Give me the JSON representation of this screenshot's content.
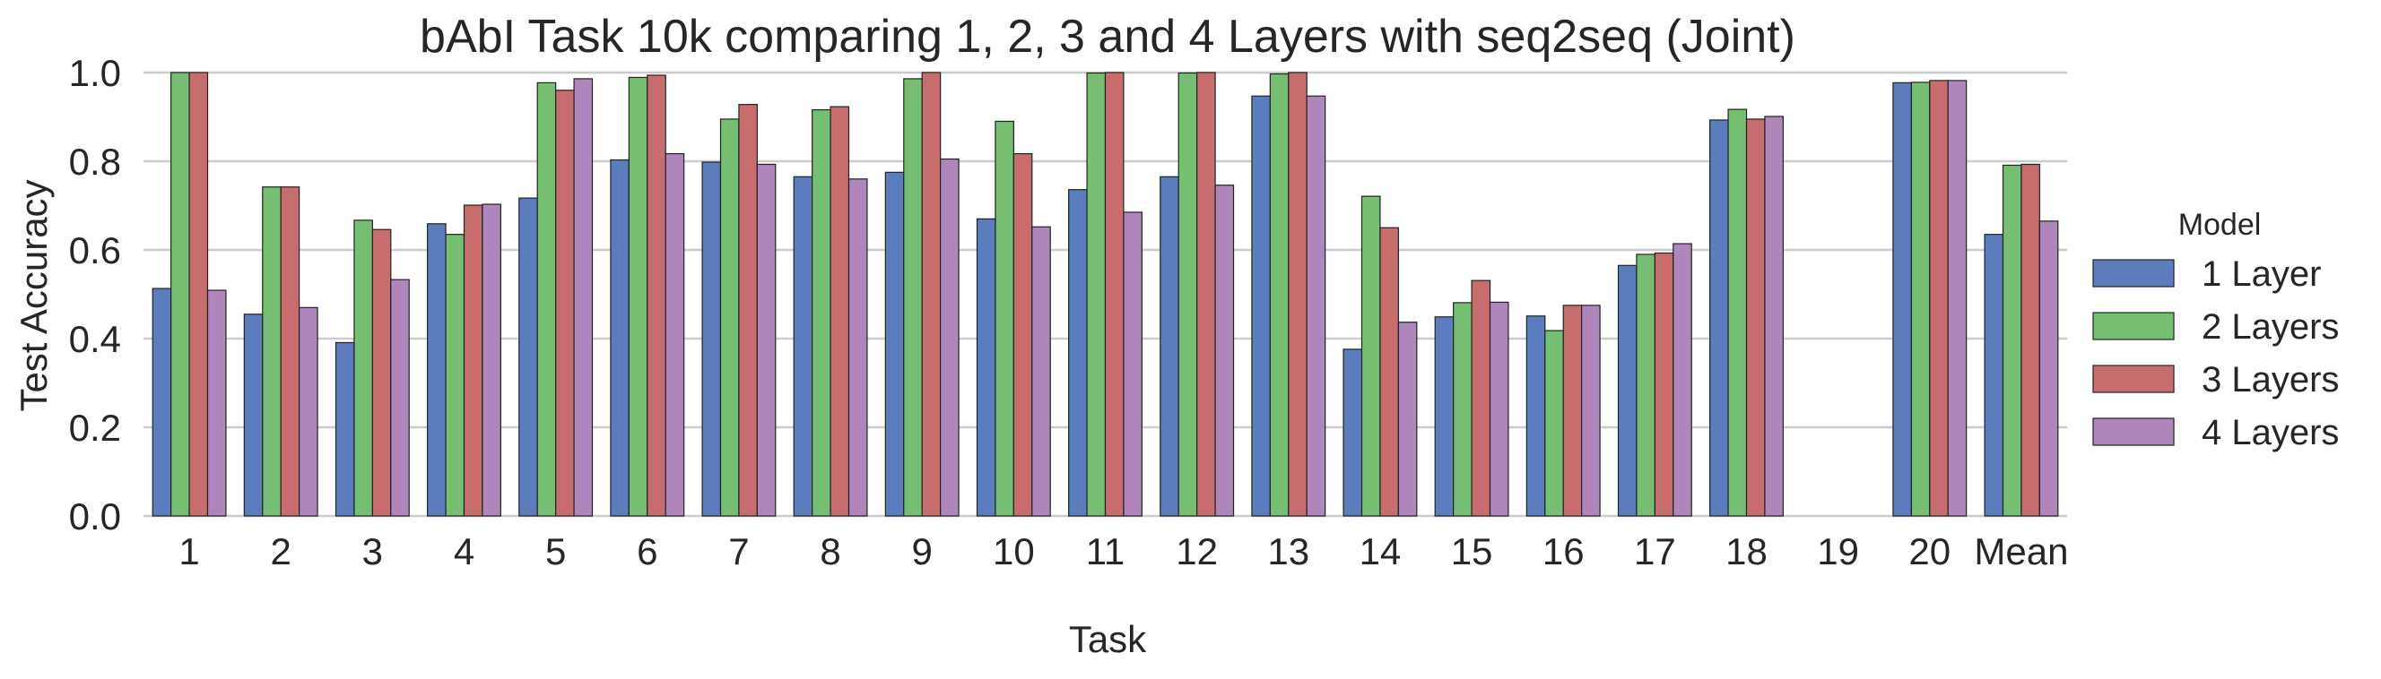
{
  "chart_data": {
    "type": "bar",
    "title": "bAbI Task 10k comparing 1, 2, 3 and 4 Layers with seq2seq (Joint)",
    "xlabel": "Task",
    "ylabel": "Test Accuracy",
    "ylim": [
      0.0,
      1.0
    ],
    "yticks": [
      "0.0",
      "0.2",
      "0.4",
      "0.6",
      "0.8",
      "1.0"
    ],
    "ytick_values": [
      0.0,
      0.2,
      0.4,
      0.6,
      0.8,
      1.0
    ],
    "grid": "horizontal",
    "categories": [
      "1",
      "2",
      "3",
      "4",
      "5",
      "6",
      "7",
      "8",
      "9",
      "10",
      "11",
      "12",
      "13",
      "14",
      "15",
      "16",
      "17",
      "18",
      "19",
      "20",
      "Mean"
    ],
    "legend": {
      "title": "Model",
      "placement": "right"
    },
    "series": [
      {
        "name": "1 Layer",
        "color": "#5b7dbe",
        "values": [
          0.513,
          0.455,
          0.391,
          0.659,
          0.717,
          0.803,
          0.798,
          0.765,
          0.775,
          0.67,
          0.736,
          0.765,
          0.947,
          0.376,
          0.449,
          0.451,
          0.565,
          0.893,
          null,
          0.977,
          0.635
        ]
      },
      {
        "name": "2 Layers",
        "color": "#76be72",
        "values": [
          1.0,
          0.742,
          0.667,
          0.635,
          0.977,
          0.989,
          0.895,
          0.916,
          0.986,
          0.89,
          0.999,
          0.999,
          0.997,
          0.721,
          0.481,
          0.418,
          0.59,
          0.917,
          null,
          0.978,
          0.791
        ]
      },
      {
        "name": "3 Layers",
        "color": "#c76d6d",
        "values": [
          1.0,
          0.742,
          0.646,
          0.701,
          0.96,
          0.994,
          0.928,
          0.923,
          1.0,
          0.817,
          1.0,
          1.0,
          1.0,
          0.65,
          0.531,
          0.475,
          0.593,
          0.895,
          null,
          0.982,
          0.793
        ]
      },
      {
        "name": "4 Layers",
        "color": "#ae86bc",
        "values": [
          0.509,
          0.47,
          0.533,
          0.703,
          0.986,
          0.817,
          0.793,
          0.76,
          0.805,
          0.652,
          0.685,
          0.746,
          0.947,
          0.437,
          0.482,
          0.475,
          0.614,
          0.901,
          null,
          0.982,
          0.665
        ]
      }
    ]
  }
}
